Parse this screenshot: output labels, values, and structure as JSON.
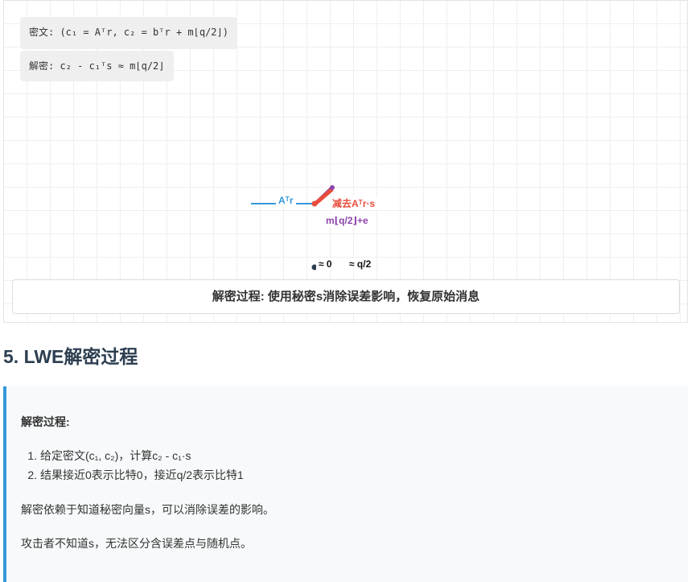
{
  "viz": {
    "formula_encrypt": "密文: (c₁ = Aᵀr, c₂ = bᵀr + m⌊q/2⌋)",
    "formula_decrypt": "解密: c₂ - c₁ᵀs ≈ m⌊q/2⌋",
    "label_atr": "Aᵀr",
    "label_subtract": "减去Aᵀr·s",
    "label_m": "m⌊q/2⌋+e",
    "label_zero": "≈ 0",
    "label_half": "≈ q/2",
    "caption": "解密过程: 使用秘密s消除误差影响，恢复原始消息",
    "colors": {
      "atr": "#3498db",
      "subtract": "#e74c3c",
      "message": "#8e44ad",
      "origin": "#2c3e50"
    }
  },
  "section": {
    "title": "5. LWE解密过程"
  },
  "note": {
    "title": "解密过程:",
    "steps": [
      "给定密文(c₁, c₂)，计算c₂ - c₁·s",
      "结果接近0表示比特0，接近q/2表示比特1"
    ],
    "p1": "解密依赖于知道秘密向量s，可以消除误差的影响。",
    "p2": "攻击者不知道s，无法区分含误差点与随机点。",
    "accent_color": "#3498db"
  }
}
